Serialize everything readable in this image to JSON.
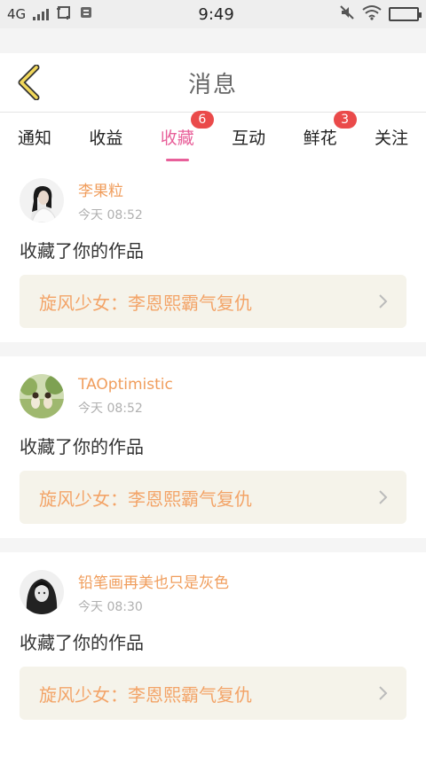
{
  "status": {
    "network": "4G",
    "time": "9:49"
  },
  "header": {
    "title": "消息"
  },
  "tabs": [
    {
      "label": "通知",
      "badge": ""
    },
    {
      "label": "收益",
      "badge": ""
    },
    {
      "label": "收藏",
      "badge": "6"
    },
    {
      "label": "互动",
      "badge": ""
    },
    {
      "label": "鲜花",
      "badge": "3"
    },
    {
      "label": "关注",
      "badge": ""
    }
  ],
  "colors": {
    "accent": "#e8609a",
    "username": "#f09d5c",
    "badge": "#ea4a4a",
    "work_bg": "#f5f3ea"
  },
  "items": [
    {
      "username": "李果粒",
      "time": "今天 08:52",
      "action": "收藏了你的作品",
      "work": "旋风少女：李恩熙霸气复仇"
    },
    {
      "username": "TAOptimistic",
      "time": "今天 08:52",
      "action": "收藏了你的作品",
      "work": "旋风少女：李恩熙霸气复仇"
    },
    {
      "username": "铅笔画再美也只是灰色",
      "time": "今天 08:30",
      "action": "收藏了你的作品",
      "work": "旋风少女：李恩熙霸气复仇"
    }
  ]
}
